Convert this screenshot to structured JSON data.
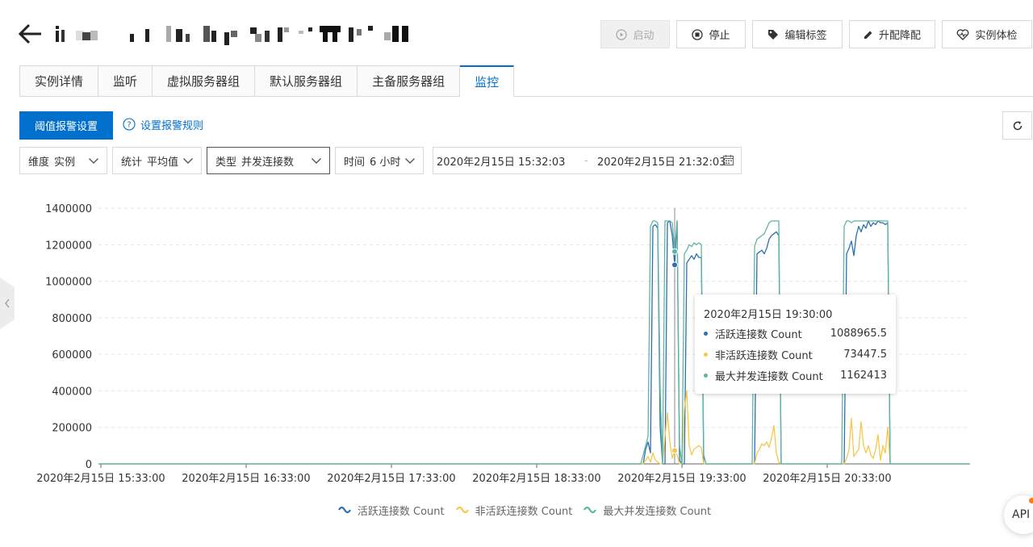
{
  "header": {
    "buttons": {
      "start": "启动",
      "stop": "停止",
      "edit_tags": "编辑标签",
      "upgrade": "升配降配",
      "health_check": "实例体检"
    }
  },
  "tabs": [
    {
      "label": "实例详情",
      "active": false
    },
    {
      "label": "监听",
      "active": false
    },
    {
      "label": "虚拟服务器组",
      "active": false
    },
    {
      "label": "默认服务器组",
      "active": false
    },
    {
      "label": "主备服务器组",
      "active": false
    },
    {
      "label": "监控",
      "active": true
    }
  ],
  "toolbar": {
    "alarm_button": "阈值报警设置",
    "rule_link": "设置报警规则"
  },
  "filters": {
    "dimension": {
      "label": "维度",
      "value": "实例"
    },
    "statistic": {
      "label": "统计",
      "value": "平均值"
    },
    "type": {
      "label": "类型",
      "value": "并发连接数"
    },
    "time": {
      "label": "时间",
      "value": "6 小时"
    },
    "date_start": "2020年2月15日 15:32:03",
    "date_sep": "-",
    "date_end": "2020年2月15日 21:32:03"
  },
  "tooltip": {
    "title": "2020年2月15日 19:30:00",
    "rows": [
      {
        "name": "活跃连接数 Count",
        "value": "1088965.5"
      },
      {
        "name": "非活跃连接数 Count",
        "value": "73447.5"
      },
      {
        "name": "最大并发连接数 Count",
        "value": "1162413"
      }
    ]
  },
  "api_button": "API",
  "colors": {
    "primary": "#0070cc",
    "active_series": "#2f6fae",
    "inactive_series": "#f5c84c",
    "max_series": "#5fb5a2",
    "grid": "#e6e6e6"
  },
  "chart_data": {
    "type": "line",
    "ylim": [
      0,
      1400000
    ],
    "y_ticks": [
      "0",
      "200000",
      "400000",
      "600000",
      "800000",
      "1000000",
      "1200000",
      "1400000"
    ],
    "x_ticks": [
      "2020年2月15日 15:33:00",
      "2020年2月15日 16:33:00",
      "2020年2月15日 17:33:00",
      "2020年2月15日 18:33:00",
      "2020年2月15日 19:33:00",
      "2020年2月15日 20:33:00"
    ],
    "x_tick_minutes": [
      0,
      60,
      120,
      180,
      240,
      300
    ],
    "x_range_minutes": [
      -1,
      359
    ],
    "legend_position": "bottom",
    "grid": true,
    "highlight_minute": 237,
    "series": [
      {
        "name": "活跃连接数 Count",
        "color": "#2f6fae",
        "points": [
          [
            -1,
            0
          ],
          [
            224,
            0
          ],
          [
            225,
            80000
          ],
          [
            226,
            120000
          ],
          [
            227,
            60000
          ],
          [
            228,
            1300000
          ],
          [
            229,
            1310000
          ],
          [
            230,
            1290000
          ],
          [
            231,
            200000
          ],
          [
            232,
            0
          ],
          [
            233,
            0
          ],
          [
            234,
            1320000
          ],
          [
            235,
            1330000
          ],
          [
            236,
            1250000
          ],
          [
            237,
            1088965.5
          ],
          [
            238,
            1330000
          ],
          [
            239,
            20000
          ],
          [
            240,
            0
          ],
          [
            241,
            0
          ],
          [
            242,
            1100000
          ],
          [
            243,
            1120000
          ],
          [
            244,
            1140000
          ],
          [
            245,
            1120000
          ],
          [
            246,
            1150000
          ],
          [
            247,
            1130000
          ],
          [
            248,
            1130000
          ],
          [
            249,
            0
          ],
          [
            250,
            0
          ],
          [
            251,
            0
          ],
          [
            270,
            0
          ],
          [
            271,
            1150000
          ],
          [
            272,
            1160000
          ],
          [
            273,
            1170000
          ],
          [
            274,
            1150000
          ],
          [
            275,
            1180000
          ],
          [
            276,
            1230000
          ],
          [
            277,
            1250000
          ],
          [
            278,
            1260000
          ],
          [
            279,
            1270000
          ],
          [
            280,
            1250000
          ],
          [
            281,
            0
          ],
          [
            282,
            0
          ],
          [
            307,
            0
          ],
          [
            308,
            1150000
          ],
          [
            309,
            1180000
          ],
          [
            310,
            1220000
          ],
          [
            311,
            1140000
          ],
          [
            312,
            1250000
          ],
          [
            313,
            1300000
          ],
          [
            314,
            1270000
          ],
          [
            315,
            1310000
          ],
          [
            316,
            1290000
          ],
          [
            317,
            1330000
          ],
          [
            318,
            1300000
          ],
          [
            319,
            1320000
          ],
          [
            320,
            1310000
          ],
          [
            321,
            1330000
          ],
          [
            322,
            1320000
          ],
          [
            323,
            1320000
          ],
          [
            324,
            1310000
          ],
          [
            325,
            1320000
          ],
          [
            326,
            0
          ],
          [
            327,
            0
          ],
          [
            359,
            0
          ]
        ]
      },
      {
        "name": "非活跃连接数 Count",
        "color": "#f5c84c",
        "points": [
          [
            -1,
            0
          ],
          [
            224,
            0
          ],
          [
            225,
            20000
          ],
          [
            226,
            40000
          ],
          [
            227,
            10000
          ],
          [
            228,
            60000
          ],
          [
            229,
            20000
          ],
          [
            230,
            10000
          ],
          [
            231,
            0
          ],
          [
            232,
            0
          ],
          [
            233,
            150000
          ],
          [
            234,
            280000
          ],
          [
            235,
            120000
          ],
          [
            236,
            30000
          ],
          [
            237,
            73447.5
          ],
          [
            238,
            50000
          ],
          [
            239,
            0
          ],
          [
            240,
            0
          ],
          [
            241,
            300000
          ],
          [
            242,
            400000
          ],
          [
            243,
            100000
          ],
          [
            244,
            50000
          ],
          [
            245,
            80000
          ],
          [
            246,
            90000
          ],
          [
            247,
            100000
          ],
          [
            248,
            90000
          ],
          [
            249,
            0
          ],
          [
            250,
            0
          ],
          [
            270,
            0
          ],
          [
            271,
            60000
          ],
          [
            272,
            80000
          ],
          [
            273,
            110000
          ],
          [
            274,
            100000
          ],
          [
            275,
            120000
          ],
          [
            276,
            90000
          ],
          [
            277,
            140000
          ],
          [
            278,
            210000
          ],
          [
            279,
            60000
          ],
          [
            280,
            10000
          ],
          [
            281,
            0
          ],
          [
            307,
            0
          ],
          [
            308,
            30000
          ],
          [
            309,
            80000
          ],
          [
            310,
            250000
          ],
          [
            311,
            40000
          ],
          [
            312,
            60000
          ],
          [
            313,
            80000
          ],
          [
            314,
            230000
          ],
          [
            315,
            100000
          ],
          [
            316,
            60000
          ],
          [
            317,
            100000
          ],
          [
            318,
            50000
          ],
          [
            319,
            30000
          ],
          [
            320,
            80000
          ],
          [
            321,
            160000
          ],
          [
            322,
            20000
          ],
          [
            323,
            100000
          ],
          [
            324,
            60000
          ],
          [
            325,
            200000
          ],
          [
            326,
            0
          ],
          [
            359,
            0
          ]
        ]
      },
      {
        "name": "最大并发连接数 Count",
        "color": "#5fb5a2",
        "points": [
          [
            -1,
            0
          ],
          [
            223,
            0
          ],
          [
            224,
            50000
          ],
          [
            225,
            100000
          ],
          [
            226,
            150000
          ],
          [
            227,
            1300000
          ],
          [
            228,
            1330000
          ],
          [
            229,
            1330000
          ],
          [
            230,
            1320000
          ],
          [
            231,
            400000
          ],
          [
            232,
            0
          ],
          [
            233,
            1330000
          ],
          [
            234,
            1330000
          ],
          [
            235,
            1330000
          ],
          [
            236,
            1320000
          ],
          [
            237,
            1162413
          ],
          [
            238,
            1330000
          ],
          [
            239,
            100000
          ],
          [
            240,
            0
          ],
          [
            241,
            1150000
          ],
          [
            242,
            1170000
          ],
          [
            243,
            1200000
          ],
          [
            244,
            1190000
          ],
          [
            245,
            1210000
          ],
          [
            246,
            1200000
          ],
          [
            247,
            1210000
          ],
          [
            248,
            1200000
          ],
          [
            249,
            50000
          ],
          [
            250,
            0
          ],
          [
            269,
            0
          ],
          [
            270,
            1190000
          ],
          [
            271,
            1230000
          ],
          [
            272,
            1240000
          ],
          [
            273,
            1250000
          ],
          [
            274,
            1260000
          ],
          [
            275,
            1290000
          ],
          [
            276,
            1320000
          ],
          [
            277,
            1330000
          ],
          [
            278,
            1330000
          ],
          [
            279,
            1330000
          ],
          [
            280,
            1330000
          ],
          [
            281,
            0
          ],
          [
            282,
            0
          ],
          [
            306,
            0
          ],
          [
            307,
            1300000
          ],
          [
            308,
            1330000
          ],
          [
            309,
            1330000
          ],
          [
            310,
            1320000
          ],
          [
            311,
            1330000
          ],
          [
            312,
            1330000
          ],
          [
            313,
            1330000
          ],
          [
            314,
            1330000
          ],
          [
            315,
            1330000
          ],
          [
            316,
            1330000
          ],
          [
            317,
            1330000
          ],
          [
            318,
            1330000
          ],
          [
            319,
            1330000
          ],
          [
            320,
            1330000
          ],
          [
            321,
            1330000
          ],
          [
            322,
            1330000
          ],
          [
            323,
            1330000
          ],
          [
            324,
            1330000
          ],
          [
            325,
            1330000
          ],
          [
            326,
            0
          ],
          [
            327,
            0
          ],
          [
            359,
            0
          ]
        ]
      }
    ]
  }
}
